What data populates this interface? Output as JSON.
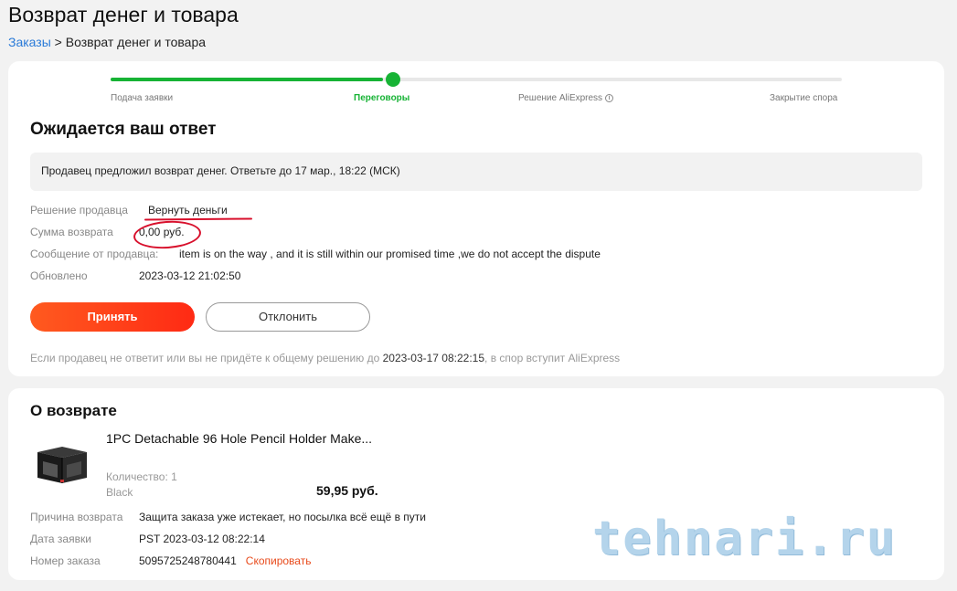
{
  "page": {
    "title": "Возврат денег и товара",
    "breadcrumb": {
      "link": "Заказы",
      "separator": " > ",
      "current": "Возврат денег и товара"
    }
  },
  "progress": {
    "steps": [
      "Подача заявки",
      "Переговоры",
      "Решение AliExpress",
      "Закрытие спора"
    ],
    "active_step": 1,
    "accent_color": "#17b335"
  },
  "status": {
    "heading": "Ожидается ваш ответ",
    "notice": "Продавец предложил возврат денег. Ответьте до 17 мар., 18:22 (МСК)",
    "details": [
      {
        "label": "Решение продавца",
        "value": "Вернуть деньги"
      },
      {
        "label": "Сумма возврата",
        "value": "0,00 руб."
      },
      {
        "label": "Сообщение от продавца:",
        "value": "item is on the way , and it is still within our promised time ,we do not accept the dispute"
      },
      {
        "label": "Обновлено",
        "value": "2023-03-12 21:02:50"
      }
    ],
    "accept_label": "Принять",
    "decline_label": "Отклонить",
    "footnote_prefix": "Если продавец не ответит или вы не придёте к общему решению до ",
    "footnote_date": "2023-03-17 08:22:15",
    "footnote_suffix": ", в спор вступит AliExpress"
  },
  "return": {
    "heading": "О возврате",
    "product": {
      "title": "1PC Detachable 96 Hole Pencil Holder Make...",
      "quantity": "Количество: 1",
      "color": "Black",
      "price": "59,95 руб."
    },
    "details": [
      {
        "label": "Причина возврата",
        "value": "Защита заказа уже истекает, но посылка всё ещё в пути"
      },
      {
        "label": "Дата заявки",
        "value": "PST 2023-03-12 08:22:14"
      },
      {
        "label": "Номер заказа",
        "value": "5095725248780441"
      }
    ],
    "copy_label": "Скопировать"
  },
  "watermark": "tehnari.ru"
}
